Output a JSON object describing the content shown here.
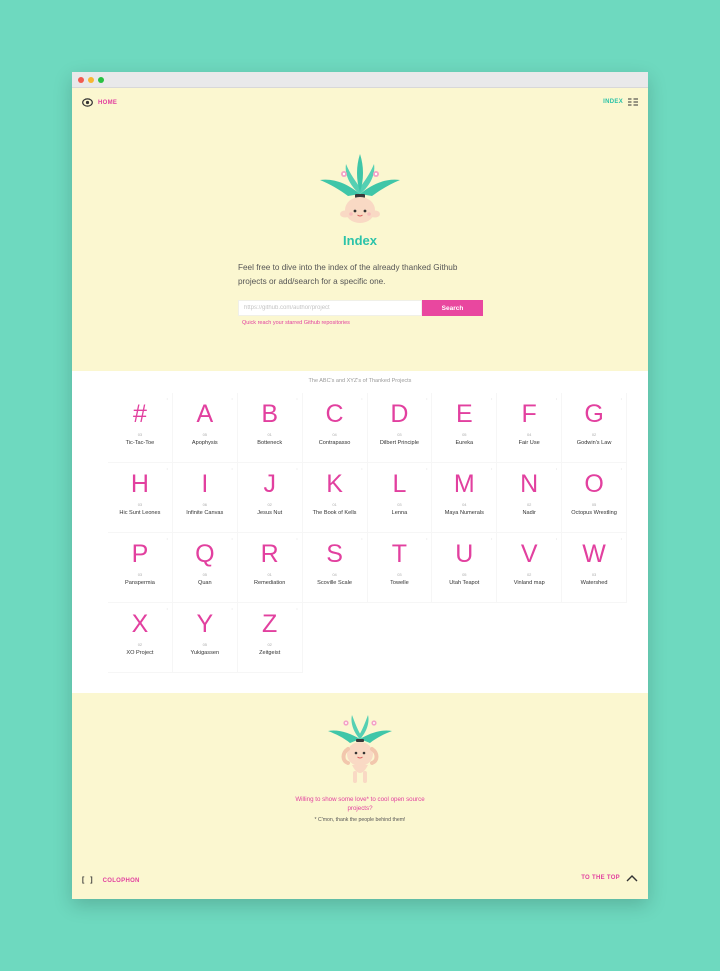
{
  "nav": {
    "home_label": "HOME",
    "index_label": "INDEX"
  },
  "hero": {
    "title": "Index",
    "description": "Feel free to dive into the index of the already thanked Github projects or add/search for a specific one.",
    "search_placeholder": "https://github.com/author/project",
    "search_button": "Search",
    "search_hint": "Quick reach your starred Github repositories"
  },
  "index": {
    "caption": "The ABC's and XYZ's of Thanked Projects",
    "letters": [
      {
        "letter": "#",
        "name": "Tic-Tac-Toe",
        "count": "03"
      },
      {
        "letter": "A",
        "name": "Apophysis",
        "count": "05"
      },
      {
        "letter": "B",
        "name": "Botteneck",
        "count": "01"
      },
      {
        "letter": "C",
        "name": "Contrapasso",
        "count": "04"
      },
      {
        "letter": "D",
        "name": "Dilbert Principle",
        "count": "03"
      },
      {
        "letter": "E",
        "name": "Eureka",
        "count": "05"
      },
      {
        "letter": "F",
        "name": "Fair Use",
        "count": "04"
      },
      {
        "letter": "G",
        "name": "Godwin's Law",
        "count": "02"
      },
      {
        "letter": "H",
        "name": "Hic Sunt Leones",
        "count": "03"
      },
      {
        "letter": "I",
        "name": "Infinite Canvas",
        "count": "06"
      },
      {
        "letter": "J",
        "name": "Jesus Nut",
        "count": "02"
      },
      {
        "letter": "K",
        "name": "The Book of Kells",
        "count": "01"
      },
      {
        "letter": "L",
        "name": "Lenna",
        "count": "03"
      },
      {
        "letter": "M",
        "name": "Maya Numerals",
        "count": "04"
      },
      {
        "letter": "N",
        "name": "Nadir",
        "count": "02"
      },
      {
        "letter": "O",
        "name": "Octopus Wrestling",
        "count": "05"
      },
      {
        "letter": "P",
        "name": "Panspermia",
        "count": "03"
      },
      {
        "letter": "Q",
        "name": "Quan",
        "count": "05"
      },
      {
        "letter": "R",
        "name": "Remediation",
        "count": "01"
      },
      {
        "letter": "S",
        "name": "Scoville Scale",
        "count": "04"
      },
      {
        "letter": "T",
        "name": "Towelle",
        "count": "03"
      },
      {
        "letter": "U",
        "name": "Utah Teapot",
        "count": "05"
      },
      {
        "letter": "V",
        "name": "Vinland map",
        "count": "02"
      },
      {
        "letter": "W",
        "name": "Watershed",
        "count": "03"
      },
      {
        "letter": "X",
        "name": "XO Project",
        "count": "02"
      },
      {
        "letter": "Y",
        "name": "Yukigassen",
        "count": "05"
      },
      {
        "letter": "Z",
        "name": "Zeitgeist",
        "count": "02"
      }
    ]
  },
  "footer": {
    "cta": "Willing to show some love* to cool open source projects?",
    "note": "* C'mon, thank the people behind them!",
    "colophon_label": "COLOPHON",
    "to_top_label": "TO THE TOP"
  },
  "colors": {
    "background": "#6ed9bf",
    "cream": "#fbf7d0",
    "pink": "#e2409f",
    "teal": "#2cc3a9"
  },
  "icons": [
    "eye-icon",
    "list-icon",
    "brackets-icon",
    "chevron-up-icon",
    "mandrake-illustration"
  ]
}
